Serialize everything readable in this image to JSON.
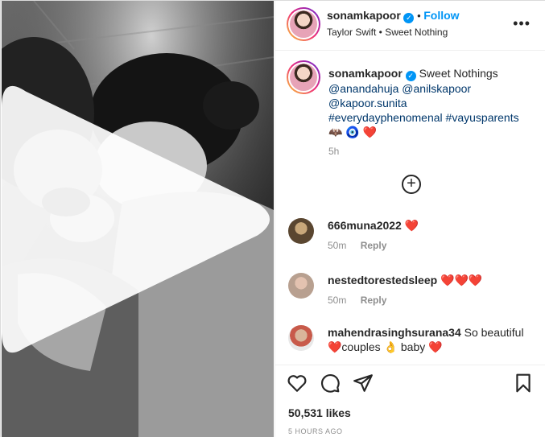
{
  "post": {
    "username": "sonamkapoor",
    "follow_label": "Follow",
    "audio": "Taylor Swift • Sweet Nothing",
    "more_label": "•••"
  },
  "caption": {
    "username": "sonamkapoor",
    "text": "Sweet Nothings",
    "mentions_line1": "@anandahuja @anilskapoor",
    "mentions_line2": "@kapoor.sunita",
    "hashtags": "#everydayphenomenal #vayusparents",
    "emojis": "🦇 🧿 ❤️",
    "time": "5h"
  },
  "comments": [
    {
      "username": "666muna2022",
      "text": "",
      "trailing": "❤️",
      "time": "50m",
      "reply_label": "Reply"
    },
    {
      "username": "nestedtorestedsleep",
      "text": "",
      "trailing": "❤️❤️❤️",
      "time": "50m",
      "reply_label": "Reply"
    },
    {
      "username": "mahendrasinghsurana34",
      "text": "So beautiful",
      "line2": "❤️couples 👌 baby ❤️"
    }
  ],
  "footer": {
    "likes": "50,531 likes",
    "posted": "5 HOURS AGO"
  },
  "colors": {
    "accent": "#0095f6",
    "heart": "#e0242b",
    "text": "#262626",
    "muted": "#8e8e8e"
  }
}
